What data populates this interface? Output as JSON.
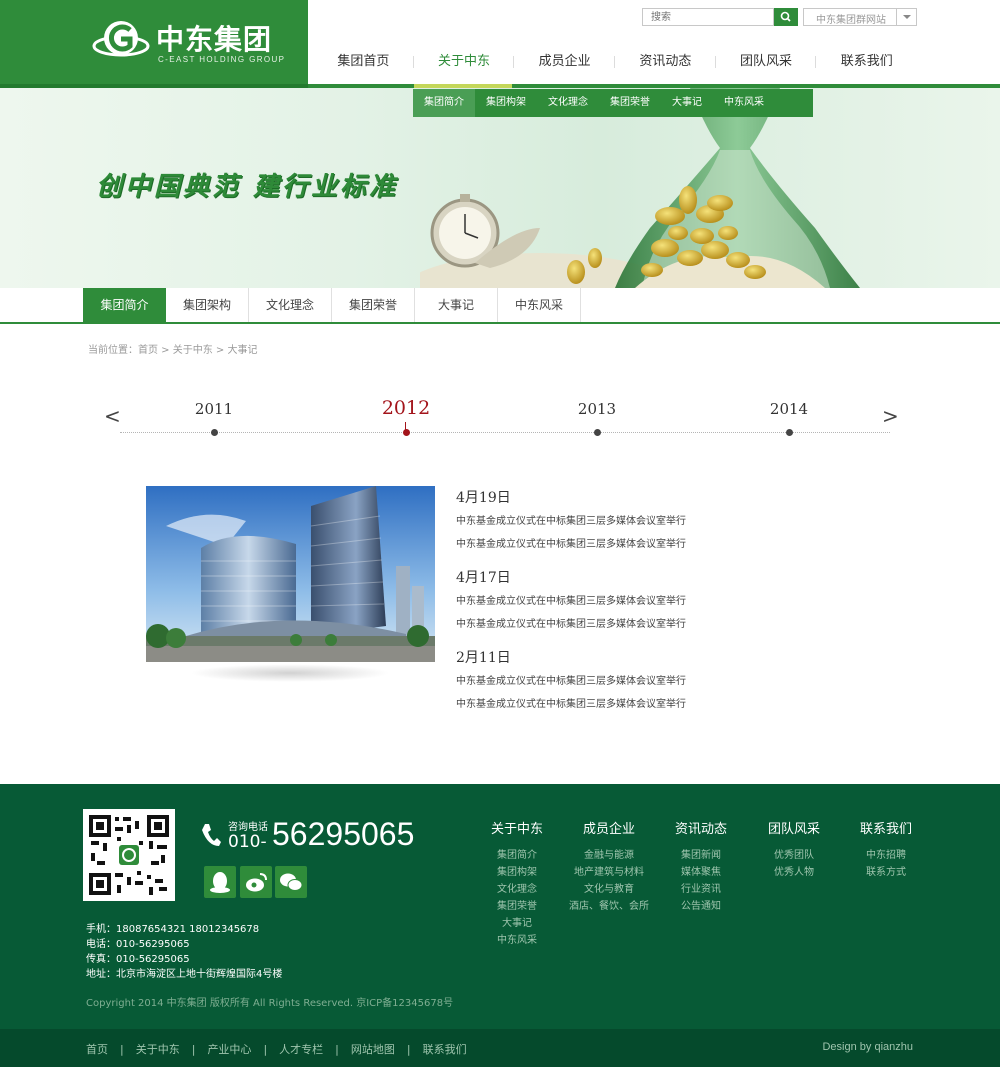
{
  "brand": {
    "name_cn": "中东集团",
    "name_en": "C-EAST HOLDING GROUP"
  },
  "search": {
    "placeholder": "搜索",
    "icon": "search-icon"
  },
  "site_select": {
    "selected": "中东集团群网站"
  },
  "main_nav": [
    {
      "label": "集团首页",
      "active": false
    },
    {
      "label": "关于中东",
      "active": true
    },
    {
      "label": "成员企业",
      "active": false
    },
    {
      "label": "资讯动态",
      "active": false
    },
    {
      "label": "团队风采",
      "active": false
    },
    {
      "label": "联系我们",
      "active": false
    }
  ],
  "dropdown": [
    "集团简介",
    "集团构架",
    "文化理念",
    "集团荣誉",
    "大事记",
    "中东风采"
  ],
  "banner": {
    "slogan": "创中国典范  建行业标准"
  },
  "sub_tabs": [
    "集团简介",
    "集团架构",
    "文化理念",
    "集团荣誉",
    "大事记",
    "中东风采"
  ],
  "breadcrumb": {
    "prefix": "当前位置：",
    "items": [
      "首页",
      "关于中东",
      "大事记"
    ],
    "separator": " > "
  },
  "timeline": {
    "prev": "<",
    "next": ">",
    "years": [
      {
        "label": "2011",
        "active": false
      },
      {
        "label": "2012",
        "active": true
      },
      {
        "label": "2013",
        "active": false
      },
      {
        "label": "2014",
        "active": false
      }
    ]
  },
  "events": [
    {
      "date": "4月19日",
      "lines": [
        "中东基金成立仪式在中标集团三层多媒体会议室举行",
        "中东基金成立仪式在中标集团三层多媒体会议室举行"
      ]
    },
    {
      "date": "4月17日",
      "lines": [
        "中东基金成立仪式在中标集团三层多媒体会议室举行",
        "中东基金成立仪式在中标集团三层多媒体会议室举行"
      ]
    },
    {
      "date": "2月11日",
      "lines": [
        "中东基金成立仪式在中标集团三层多媒体会议室举行",
        "中东基金成立仪式在中标集团三层多媒体会议室举行"
      ]
    }
  ],
  "footer": {
    "phone_label": "咨询电话",
    "phone_prefix": "010-",
    "phone_number": "56295065",
    "social_icons": [
      "qq-icon",
      "weibo-icon",
      "wechat-icon"
    ],
    "contact": [
      "手机：18087654321  18012345678",
      "电话：010-56295065",
      "传真：010-56295065",
      "地址：北京市海淀区上地十街辉煌国际4号楼"
    ],
    "copyright": "Copyright 2014 中东集团 版权所有 All Rights Reserved.   京ICP备12345678号",
    "columns": [
      {
        "title": "关于中东",
        "links": [
          "集团简介",
          "集团构架",
          "文化理念",
          "集团荣誉",
          "大事记",
          "中东风采"
        ]
      },
      {
        "title": "成员企业",
        "links": [
          "金融与能源",
          "地产建筑与材料",
          "文化与教育",
          "酒店、餐饮、会所"
        ]
      },
      {
        "title": "资讯动态",
        "links": [
          "集团新闻",
          "媒体聚焦",
          "行业资讯",
          "公告通知"
        ]
      },
      {
        "title": "团队风采",
        "links": [
          "优秀团队",
          "优秀人物"
        ]
      },
      {
        "title": "联系我们",
        "links": [
          "中东招聘",
          "联系方式"
        ]
      }
    ]
  },
  "bottom_bar": {
    "links": [
      "首页",
      "关于中东",
      "产业中心",
      "人才专栏",
      "网站地图",
      "联系我们"
    ],
    "design_by": "Design by qianzhu"
  },
  "colors": {
    "brand_green": "#2f8c3a",
    "footer_green": "#075a36",
    "timeline_active": "#a3141b"
  }
}
